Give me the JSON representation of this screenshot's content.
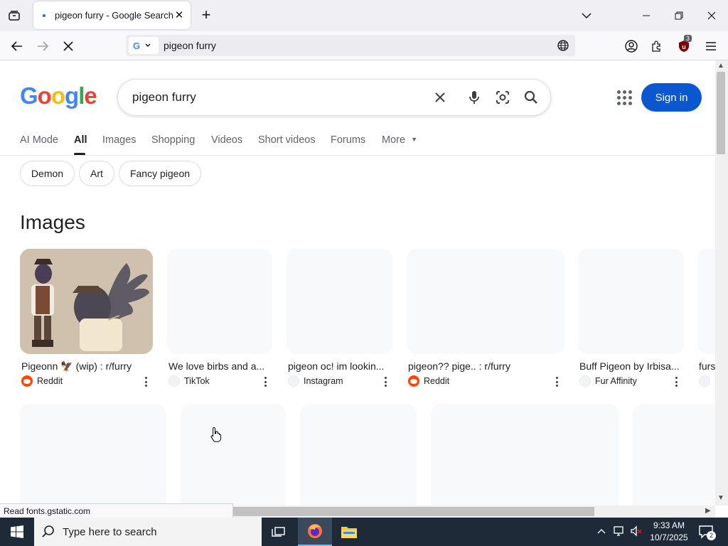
{
  "browser": {
    "tab": {
      "title": "pigeon furry - Google Search",
      "close": "✕"
    },
    "new_tab": "+",
    "url_text": "pigeon furry",
    "extension_badge": "3",
    "status_text": "Read fonts.gstatic.com"
  },
  "google": {
    "logo": [
      "G",
      "o",
      "o",
      "g",
      "l",
      "e"
    ],
    "logo_colors": [
      "#4285f4",
      "#ea4335",
      "#fbbc05",
      "#4285f4",
      "#34a853",
      "#ea4335"
    ],
    "query": "pigeon furry",
    "sign_in": "Sign in",
    "tabs": [
      "AI Mode",
      "All",
      "Images",
      "Shopping",
      "Videos",
      "Short videos",
      "Forums",
      "More"
    ],
    "active_tab": "All",
    "chips": [
      "Demon",
      "Art",
      "Fancy pigeon"
    ],
    "images_heading": "Images",
    "image_results": [
      {
        "title": "Pigeonn 🦅 (wip) : r/furry",
        "source": "Reddit",
        "source_icon": "reddit-icon"
      },
      {
        "title": "We love birbs and a...",
        "source": "TikTok",
        "source_icon": "tiktok-icon"
      },
      {
        "title": "pigeon oc! im lookin...",
        "source": "Instagram",
        "source_icon": "instagram-icon"
      },
      {
        "title": "pigeon?? pige.. : r/furry",
        "source": "Reddit",
        "source_icon": "reddit-icon"
      },
      {
        "title": "Buff Pigeon by Irbisa...",
        "source": "Fur Affinity",
        "source_icon": "furaffinity-icon"
      },
      {
        "title": "furs",
        "source": "",
        "source_icon": "site-icon"
      }
    ]
  },
  "taskbar": {
    "search_placeholder": "Type here to search",
    "time": "9:33 AM",
    "date": "10/7/2025",
    "notification_count": "2"
  },
  "colors": {
    "accent": "#0b57d0",
    "reddit": "#ff4500",
    "taskbar": "#1e2a38"
  }
}
